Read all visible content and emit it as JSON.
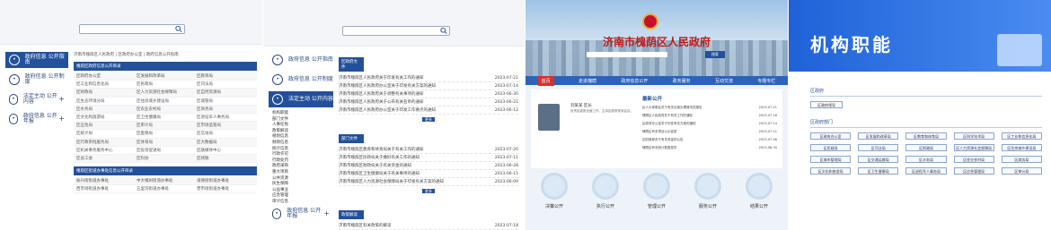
{
  "panel1": {
    "side_items": [
      {
        "label": "政府信息 公开指南",
        "icon": "compass-icon",
        "active": true
      },
      {
        "label": "政府信息 公开制度",
        "icon": "document-icon",
        "active": false
      },
      {
        "label": "法定主动 公开内容",
        "icon": "list-icon",
        "active": false,
        "expand": "+"
      },
      {
        "label": "政府信息 公开年报",
        "icon": "report-icon",
        "active": false,
        "expand": "+"
      }
    ],
    "breadcrumb": "济南市槐荫区人民政府 | 区政府办公室 | 政府信息公开指南",
    "table1_title": "槐荫区政府信息公开目录",
    "rows1": [
      [
        "区政府办公室",
        "区发展和改革局",
        "区教育局"
      ],
      [
        "区工业和信息化局",
        "区民政局",
        "区司法局"
      ],
      [
        "区财政局",
        "区人力资源社会保障局",
        "区自然资源局"
      ],
      [
        "区生态环境分局",
        "区住房城乡建设局",
        "区城管局"
      ],
      [
        "区水务局",
        "区农业农村局",
        "区商务局"
      ],
      [
        "区文化和旅游局",
        "区卫生健康局",
        "区退役军人事务局"
      ],
      [
        "区应急局",
        "区审计局",
        "区市场监管局"
      ],
      [
        "区统计局",
        "区医保局",
        "区信访局"
      ],
      [
        "区行政审批服务局",
        "区体育局",
        "区大数据局"
      ],
      [
        "区机关事务服务中心",
        "区投资促进局",
        "区融媒体中心"
      ],
      [
        "区总工会",
        "区科协",
        "区残联"
      ]
    ],
    "table2_title": "槐荫区街道办事处信息公开目录",
    "rows2": [
      [
        "振兴街街道办事处",
        "中大槐树街道办事处",
        "道德街街道办事处"
      ],
      [
        "西市场街道办事处",
        "五里沟街道办事处",
        "营市街街道办事处"
      ]
    ]
  },
  "panel2": {
    "side_items": [
      {
        "label": "政府信息 公开指南",
        "icon": "compass-icon",
        "active": false
      },
      {
        "label": "政府信息 公开制度",
        "icon": "document-icon",
        "active": false
      },
      {
        "label": "法定主动 公开内容",
        "icon": "list-icon",
        "active": true
      },
      {
        "label": "政府信息 公开年报",
        "icon": "report-icon",
        "active": false,
        "expand": "+"
      }
    ],
    "sub_items": [
      "机构职能",
      "部门文件",
      "人事任免",
      "政策解读",
      "规划信息",
      "财政信息",
      "统计信息",
      "行政许可",
      "行政处罚",
      "政府采购",
      "重大项目",
      "公共资源",
      "民生保障",
      "公益事业",
      "应急管理",
      "审计信息"
    ],
    "sections": [
      {
        "title": "区政府文件",
        "items": [
          [
            "济南市槐荫区人民政府关于印发有关工作的通知",
            "2023-07-21"
          ],
          [
            "济南市槐荫区人民政府办公室关于印发有关方案的通知",
            "2023-07-14"
          ],
          [
            "济南市槐荫区人民政府关于调整有关事项的通知",
            "2023-06-30"
          ],
          [
            "济南市槐荫区人民政府关于公布有关名单的通知",
            "2023-06-21"
          ],
          [
            "济南市槐荫区人民政府办公室关于印发工作要点的通知",
            "2023-06-12"
          ]
        ],
        "more": "更多"
      },
      {
        "title": "部门文件",
        "items": [
          [
            "济南市槐荫区教育和体育局关于有关工作的通知",
            "2023-07-20"
          ],
          [
            "济南市槐荫区民政局关于做好有关工作的通知",
            "2023-07-11"
          ],
          [
            "济南市槐荫区财政局关于有关资金的通知",
            "2023-06-28"
          ],
          [
            "济南市槐荫区卫生健康局关于有关事项的通知",
            "2023-06-15"
          ],
          [
            "济南市槐荫区人力资源社会保障局关于印发有关方案的通知",
            "2023-06-09"
          ]
        ],
        "more": "更多"
      },
      {
        "title": "政策解读",
        "items": [
          [
            "济南市槐荫区有关政策的解读",
            "2023-07-18"
          ]
        ],
        "more": ""
      }
    ]
  },
  "panel3": {
    "site_title": "济南市槐荫区人民政府",
    "search_btn": "搜索",
    "nav": [
      "首页",
      "走进槐荫",
      "政府信息公开",
      "政务服务",
      "互动交流",
      "专题专栏"
    ],
    "official_name": "刘某某  区长",
    "official_text": "负责区政府全面工作，主持区政府常务会议。",
    "latest_title": "最新公开",
    "latest": [
      [
        "区人大常委会关于有关议案办理情况的报告",
        "2023-07-21"
      ],
      [
        "槐荫区人民政府关于有关工作的通知",
        "2023-07-18"
      ],
      [
        "区政府办公室关于印发有关方案的通知",
        "2023-07-14"
      ],
      [
        "槐荫区有关项目公示信息",
        "2023-07-11"
      ],
      [
        "区财政局关于有关资金的公告",
        "2023-07-06"
      ],
      [
        "槐荫区有关统计数据发布",
        "2023-06-30"
      ]
    ],
    "cards": [
      "决策公开",
      "执行公开",
      "管理公开",
      "服务公开",
      "结果公开"
    ]
  },
  "panel4": {
    "title": "机构职能",
    "gov_heading": "区政府",
    "gov_item": "区政府领导",
    "dept_heading": "区政府部门",
    "depts": [
      "区政府办公室",
      "区发展和改革局",
      "区教育和体育局",
      "区科学技术局",
      "区工业和信息化局",
      "区民政局",
      "区司法局",
      "区财政局",
      "区人力资源社会保障局",
      "区住房城乡建设局",
      "区城市管理局",
      "区交通运输局",
      "区水务局",
      "区农业农村局",
      "区商务局",
      "区文化和旅游局",
      "区卫生健康局",
      "区退役军人事务局",
      "区应急管理局",
      "区审计局"
    ]
  },
  "colors": {
    "primary": "#23509a",
    "red": "#c01c1c",
    "blue_banner": "#1f62d8"
  }
}
